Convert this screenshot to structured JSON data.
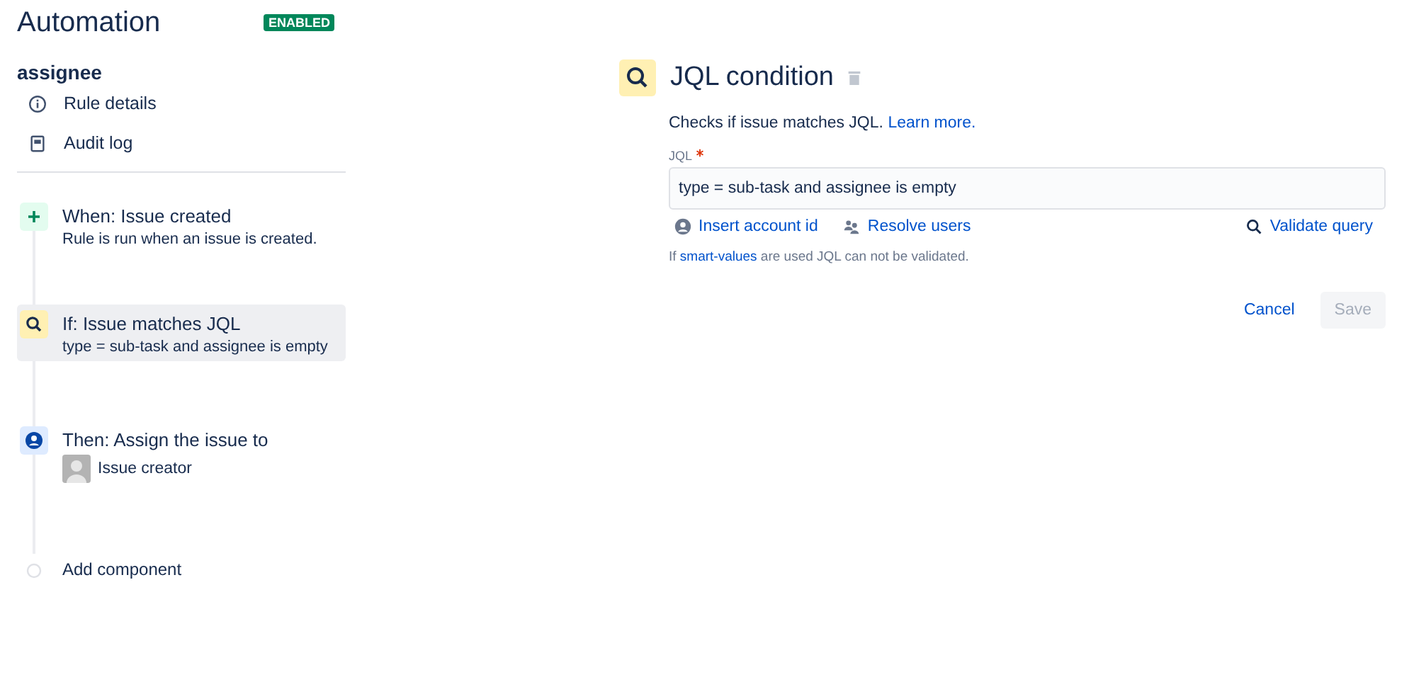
{
  "header": {
    "title": "Automation",
    "status_badge": "ENABLED",
    "enabled": true
  },
  "rule": {
    "name": "assignee",
    "links": [
      {
        "kind": "info",
        "label": "Rule details"
      },
      {
        "kind": "log",
        "label": "Audit log"
      }
    ]
  },
  "steps": [
    {
      "kind": "trigger",
      "title": "When: Issue created",
      "detail": "Rule is run when an issue is created.",
      "selected": false
    },
    {
      "kind": "condition",
      "title": "If: Issue matches JQL",
      "detail": "type = sub-task and assignee is empty",
      "selected": true
    },
    {
      "kind": "action",
      "title": "Then: Assign the issue to",
      "detail": "Issue creator",
      "selected": false
    },
    {
      "kind": "add",
      "title": "Add component",
      "selected": false
    }
  ],
  "panel": {
    "title": "JQL condition",
    "description": "Checks if issue matches JQL.",
    "learn_more": "Learn more.",
    "field_label": "JQL",
    "required": true,
    "field_value": "type = sub-task and assignee is empty",
    "tools": [
      {
        "kind": "account",
        "label": "Insert account id"
      },
      {
        "kind": "users",
        "label": "Resolve users"
      },
      {
        "kind": "validate",
        "label": "Validate query"
      }
    ],
    "hint_before": "If",
    "hint_link": "smart-values",
    "hint_after": "are used JQL can not be validated.",
    "cancel": "Cancel",
    "save": "Save",
    "save_disabled": true
  }
}
